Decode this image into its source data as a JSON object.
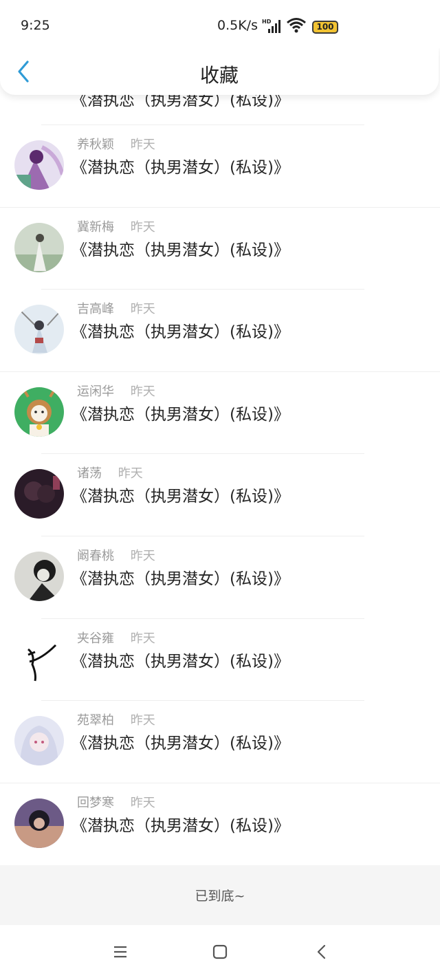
{
  "status_bar": {
    "time": "9:25",
    "network_speed": "0.5K/s",
    "signal_label": "HD",
    "battery": "100"
  },
  "header": {
    "title": "收藏"
  },
  "items": [
    {
      "name": "",
      "time": "",
      "title": "《潜执恋（执男潜女）(私设)》",
      "avatar": "mist"
    },
    {
      "name": "养秋颖",
      "time": "昨天",
      "title": "《潜执恋（执男潜女）(私设)》",
      "avatar": "purple"
    },
    {
      "name": "冀新梅",
      "time": "昨天",
      "title": "《潜执恋（执男潜女）(私设)》",
      "avatar": "field"
    },
    {
      "name": "吉高峰",
      "time": "昨天",
      "title": "《潜执恋（执男潜女）(私设)》",
      "avatar": "snow"
    },
    {
      "name": "运闲华",
      "time": "昨天",
      "title": "《潜执恋（执男潜女）(私设)》",
      "avatar": "deer"
    },
    {
      "name": "诸荡",
      "time": "昨天",
      "title": "《潜执恋（执男潜女）(私设)》",
      "avatar": "night"
    },
    {
      "name": "阚春桃",
      "time": "昨天",
      "title": "《潜执恋（执男潜女）(私设)》",
      "avatar": "sketch"
    },
    {
      "name": "夹谷雍",
      "time": "昨天",
      "title": "《潜执恋（执男潜女）(私设)》",
      "avatar": "glyph"
    },
    {
      "name": "苑翠柏",
      "time": "昨天",
      "title": "《潜执恋（执男潜女）(私设)》",
      "avatar": "silver"
    },
    {
      "name": "回梦寒",
      "time": "昨天",
      "title": "《潜执恋（执男潜女）(私设)》",
      "avatar": "dusk"
    }
  ],
  "footer": {
    "end_text": "已到底~"
  },
  "system_nav": {
    "menu_icon": "menu-icon",
    "home_icon": "square-icon",
    "back_icon": "triangle-back-icon"
  },
  "colors": {
    "accent": "#2f9bd6",
    "background": "#ffffff",
    "footer_bg": "#f5f5f5"
  }
}
